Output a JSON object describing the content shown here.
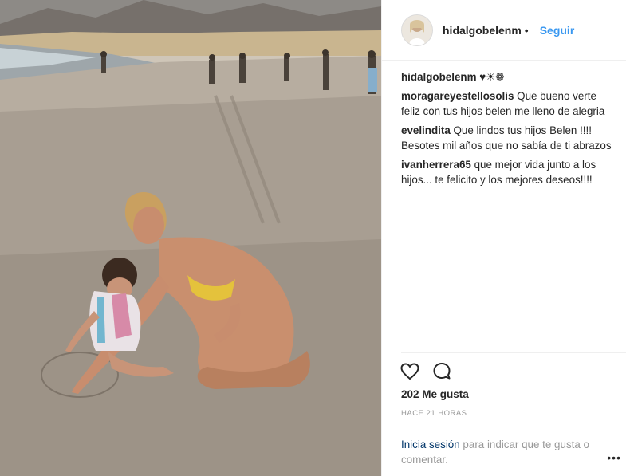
{
  "header": {
    "username": "hidalgobelenm",
    "dot": "•",
    "follow_label": "Seguir"
  },
  "caption": {
    "user": "hidalgobelenm",
    "text": "♥☀❁"
  },
  "comments": [
    {
      "user": "moragareyestellosolis",
      "text": "Que bueno verte feliz con tus hijos belen me lleno de alegria"
    },
    {
      "user": "evelindita",
      "text": "Que lindos tus hijos Belen !!!! Besotes mil años que no sabía de ti abrazos"
    },
    {
      "user": "ivanherrera65",
      "text": "que mejor vida junto a los hijos... te felicito y los mejores deseos!!!!"
    }
  ],
  "actions": {
    "like_icon": "heart-icon",
    "comment_icon": "comment-bubble-icon",
    "likes_text": "202 Me gusta",
    "time_text": "HACE 21 HORAS"
  },
  "login_prompt": {
    "link_text": "Inicia sesión",
    "rest_text": " para indicar que te gusta o comentar."
  },
  "more_label": "•••",
  "colors": {
    "link_blue": "#3897f0",
    "dark_link": "#003569",
    "muted": "#999999",
    "text": "#262626"
  }
}
